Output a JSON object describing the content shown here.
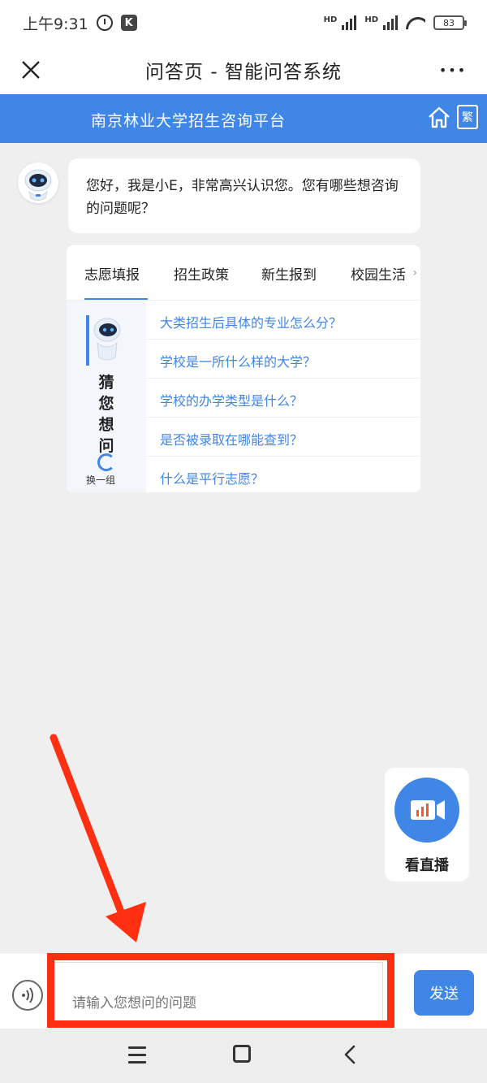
{
  "status": {
    "time": "上午9:31",
    "k_badge": "K",
    "hd1": "HD",
    "hd2": "HD",
    "battery": "83"
  },
  "titlebar": {
    "title": "问答页 - 智能问答系统",
    "close_icon": "close-icon",
    "more_icon": "more-icon",
    "more_glyph": "•••"
  },
  "header": {
    "title": "南京林业大学招生咨询平台",
    "home_icon": "home-icon",
    "trad_label": "繁"
  },
  "chat": {
    "greeting": "您好，我是小E，非常高兴认识您。您有哪些想咨询的问题呢？",
    "tabs": [
      {
        "label": "志愿填报",
        "active": true
      },
      {
        "label": "招生政策",
        "active": false
      },
      {
        "label": "新生报到",
        "active": false
      },
      {
        "label": "校园生活",
        "active": false
      }
    ],
    "guess_title": "猜您想问",
    "refresh_label": "换一组",
    "questions": [
      "大类招生后具体的专业怎么分？",
      "学校是一所什么样的大学？",
      "学校的办学类型是什么？",
      "是否被录取在哪能查到？",
      "什么是平行志愿？"
    ]
  },
  "live": {
    "label": "看直播",
    "icon": "video-camera-icon"
  },
  "input": {
    "placeholder": "请输入您想问的问题",
    "send_label": "发送",
    "voice_icon": "voice-icon"
  },
  "colors": {
    "accent": "#3f86e6",
    "annotation_red": "#ff2f12",
    "background": "#efefef"
  }
}
